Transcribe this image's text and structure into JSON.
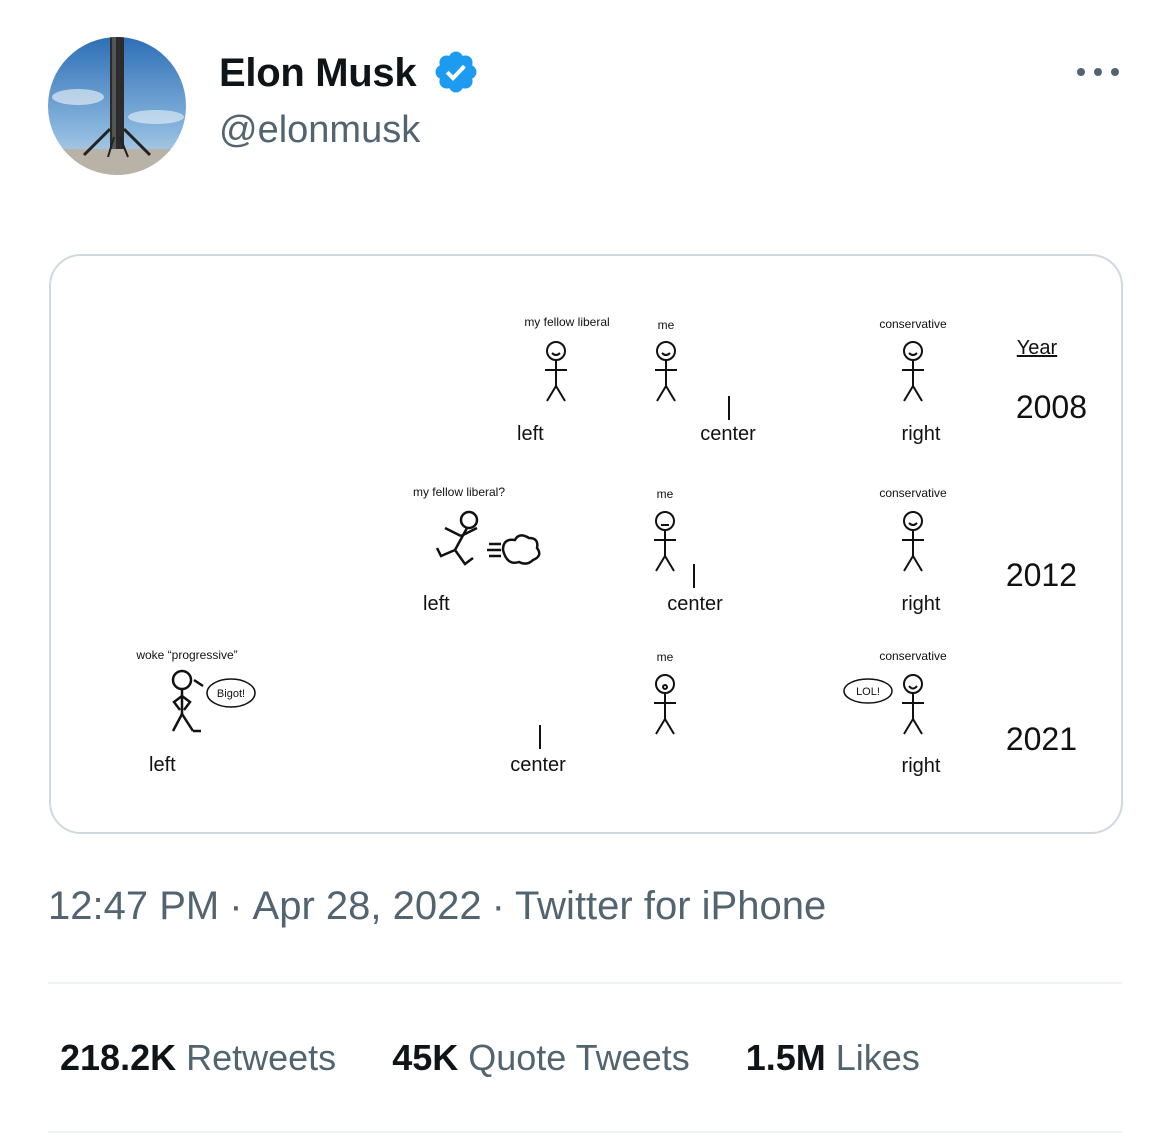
{
  "tweet": {
    "author_name": "Elon Musk",
    "handle": "@elonmusk",
    "verified": true,
    "more_icon": "more-horizontal-icon",
    "time": "12:47 PM",
    "date": "Apr 28, 2022",
    "source": "Twitter for iPhone",
    "separator": "·",
    "stats": {
      "retweets_count": "218.2K",
      "retweets_label": "Retweets",
      "quotes_count": "45K",
      "quotes_label": "Quote Tweets",
      "likes_count": "1.5M",
      "likes_label": "Likes"
    }
  },
  "cartoon": {
    "year_header": "Year",
    "left": "left",
    "center": "center",
    "right": "right",
    "rows": [
      {
        "year": "2008",
        "liberal_label": "my fellow liberal",
        "me_label": "me",
        "conservative_label": "conservative"
      },
      {
        "year": "2012",
        "liberal_label": "my fellow liberal?",
        "me_label": "me",
        "conservative_label": "conservative"
      },
      {
        "year": "2021",
        "liberal_label": "woke “progressive”",
        "me_label": "me",
        "conservative_label": "conservative",
        "bigot_bubble": "Bigot!",
        "lol_bubble": "LOL!"
      }
    ],
    "colors": {
      "left_blue": "#4a6fb5",
      "right_red": "#d9534f"
    }
  }
}
